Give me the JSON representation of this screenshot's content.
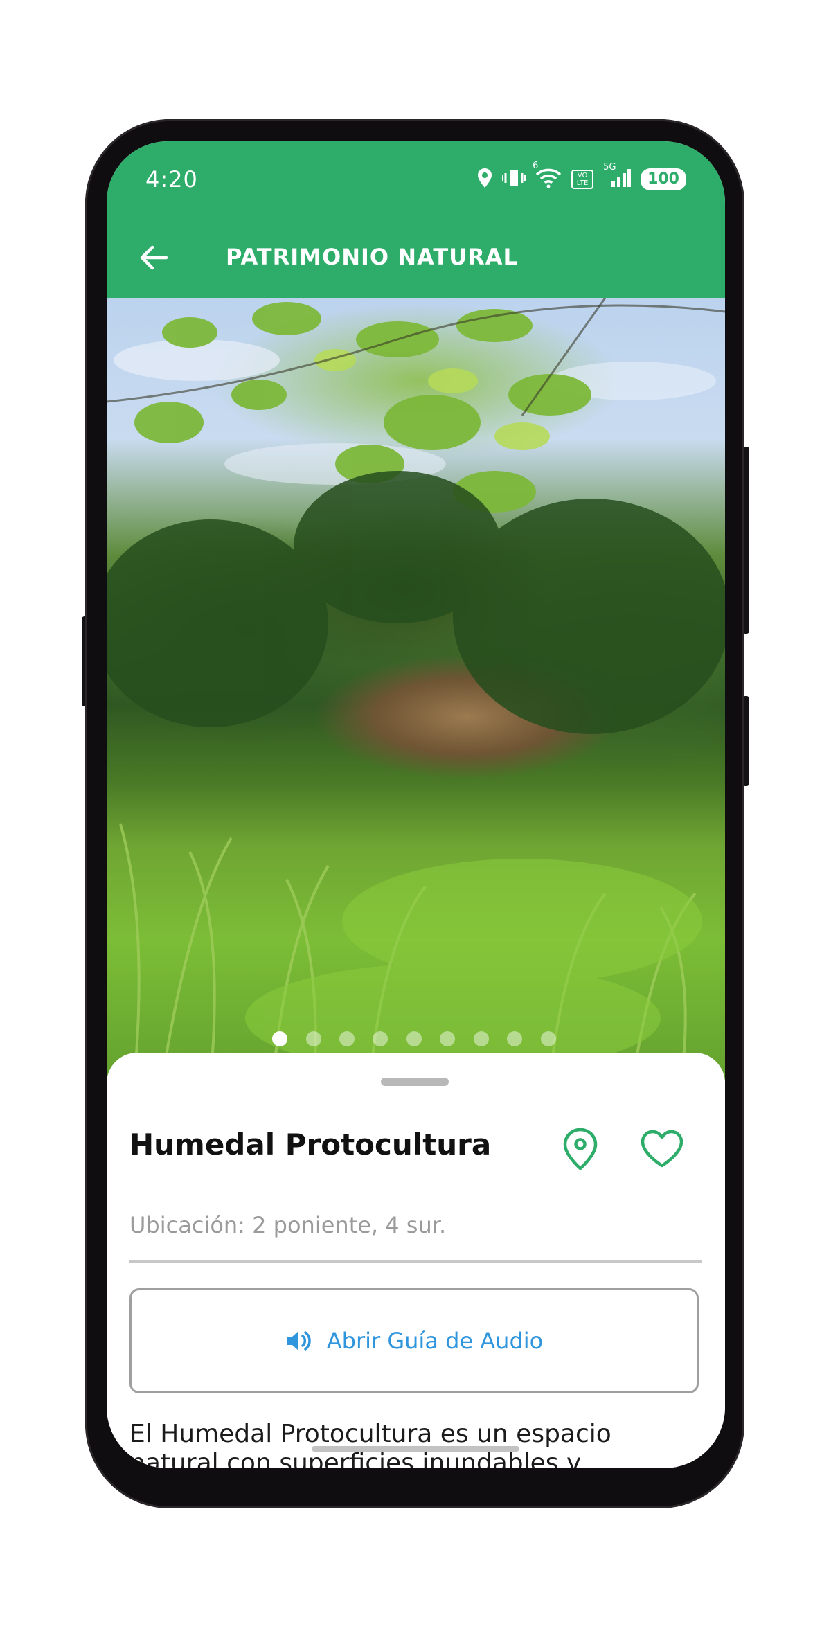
{
  "status_bar": {
    "time": "4:20",
    "battery": "100",
    "network": "5G",
    "volte": "VO LTE",
    "wifi_badge": "6"
  },
  "app_bar": {
    "title": "PATRIMONIO NATURAL",
    "back_icon": "arrow-left-icon"
  },
  "gallery": {
    "image_count": 9,
    "active_index": 0
  },
  "place": {
    "title": "Humedal Protocultura",
    "location": "Ubicación: 2 poniente, 4 sur.",
    "audio_button_label": "Abrir Guía de Audio",
    "description": "El Humedal Protocultura es un espacio natural con superficies inundables y"
  },
  "colors": {
    "primary": "#2ead6a",
    "accent_link": "#2f95dc",
    "icon_green": "#2ead6a"
  }
}
